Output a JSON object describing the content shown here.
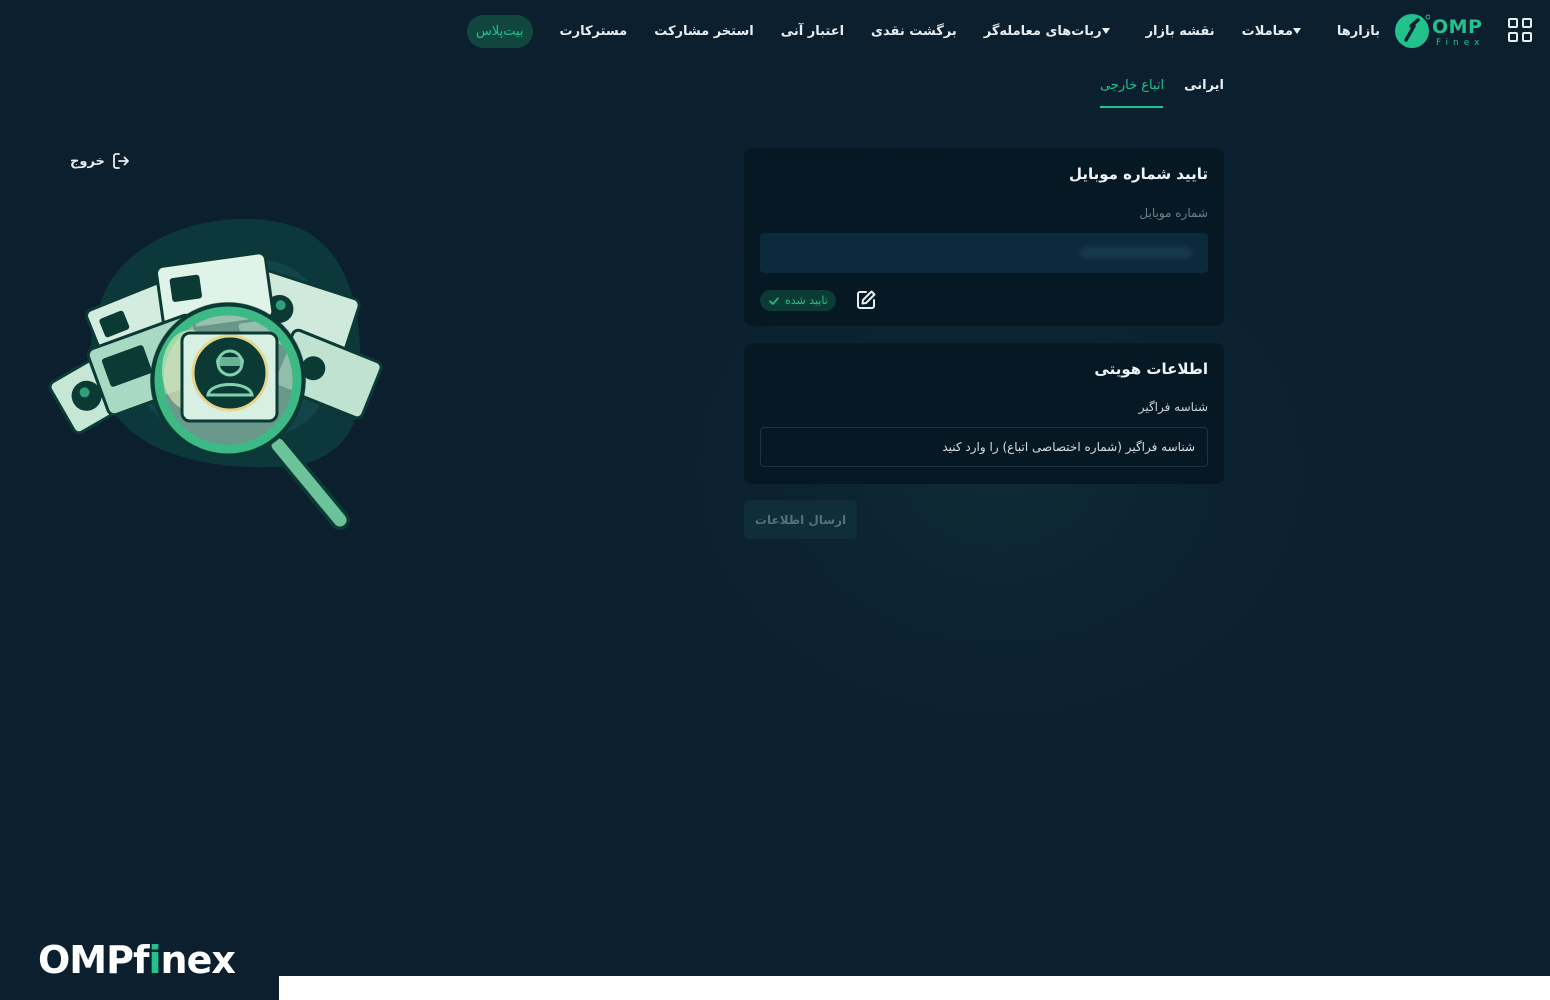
{
  "header": {
    "logo": {
      "brand": "OMP",
      "sub": "Finex"
    },
    "apps_icon": "grid-apps-icon",
    "nav": [
      {
        "label": "بازارها",
        "has_dropdown": false
      },
      {
        "label": "معاملات",
        "has_dropdown": true
      },
      {
        "label": "نقشه بازار",
        "has_dropdown": false
      },
      {
        "label": "ربات‌های معامله‌گر",
        "has_dropdown": true
      },
      {
        "label": "برگشت نقدی",
        "has_dropdown": false
      },
      {
        "label": "اعتبار آنی",
        "has_dropdown": false
      },
      {
        "label": "استخر مشارکت",
        "has_dropdown": false
      },
      {
        "label": "مسترکارت",
        "has_dropdown": false
      },
      {
        "label": "بیت‌پلاس",
        "has_dropdown": false,
        "highlighted": true
      }
    ]
  },
  "tabs": {
    "iranian": "ایرانی",
    "foreign": "اتباع خارجی",
    "active": "foreign"
  },
  "mobile_card": {
    "title": "تایید شماره موبایل",
    "field_label": "شماره موبایل",
    "value_hidden": true,
    "status": "تایید شده",
    "status_icon": "check-icon",
    "edit_icon": "edit-icon"
  },
  "identity_card": {
    "title": "اطلاعات هویتی",
    "field_label": "شناسه فراگیر",
    "placeholder": "شناسه فراگیر (شماره اختصاصی اتباع) را وارد کنید"
  },
  "submit_label": "ارسال اطلاعات",
  "logout": {
    "label": "خروج",
    "icon": "logout-icon"
  },
  "illustration": "identity-verification-magnifier-illustration",
  "watermark": {
    "prefix": "OMPf",
    "accent": "i",
    "suffix": "nex"
  },
  "colors": {
    "background": "#0b1f2f",
    "card": "#061823",
    "accent": "#23c28d",
    "input_fill": "#0d2a3c",
    "button_disabled": "#0f2d3b"
  }
}
